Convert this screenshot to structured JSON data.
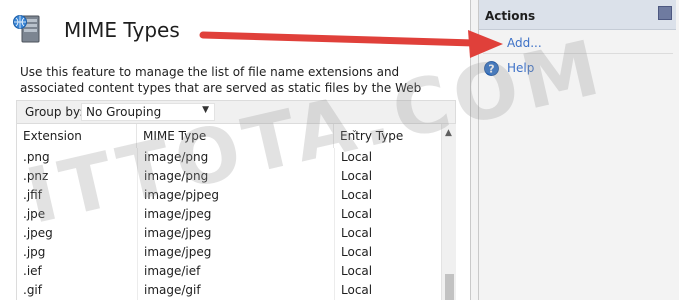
{
  "feature": {
    "title": "MIME Types",
    "icon": "server-icon",
    "description": "Use this feature to manage the list of file name extensions and associated content types that are served as static files by the Web server."
  },
  "group_by": {
    "label": "Group by:",
    "value": "No Grouping"
  },
  "table": {
    "columns": [
      "Extension",
      "MIME Type",
      "Entry Type"
    ],
    "rows": [
      {
        "extension": ".png",
        "mime": "image/png",
        "entry": "Local"
      },
      {
        "extension": ".pnz",
        "mime": "image/png",
        "entry": "Local"
      },
      {
        "extension": ".jfif",
        "mime": "image/pjpeg",
        "entry": "Local"
      },
      {
        "extension": ".jpe",
        "mime": "image/jpeg",
        "entry": "Local"
      },
      {
        "extension": ".jpeg",
        "mime": "image/jpeg",
        "entry": "Local"
      },
      {
        "extension": ".jpg",
        "mime": "image/jpeg",
        "entry": "Local"
      },
      {
        "extension": ".ief",
        "mime": "image/ief",
        "entry": "Local"
      },
      {
        "extension": ".gif",
        "mime": "image/gif",
        "entry": "Local"
      }
    ]
  },
  "actions": {
    "title": "Actions",
    "add_label": "Add...",
    "help_label": "Help"
  },
  "watermark": "ITTOTA.COM",
  "colors": {
    "link": "#3d71c7",
    "actions_header": "#dbe1ea",
    "annotation_arrow": "#e0403a"
  }
}
